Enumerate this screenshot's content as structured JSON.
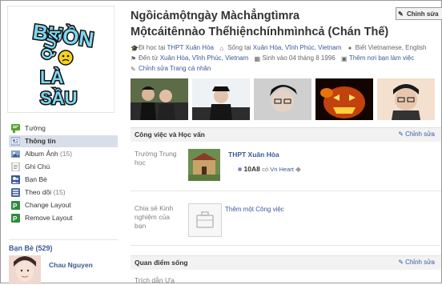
{
  "profile": {
    "name_line1": "Ngồicảmộtngày Màchẳngtìmra",
    "name_line2": "Mộtcáitênnào Thểhiệnchínhmìnhcả (Chán Thế)",
    "edit_profile_label": "Chỉnh sửa",
    "picture_text": [
      "BUỒN",
      "QUÁ",
      "LÀ",
      "SẦU"
    ]
  },
  "facts": {
    "studied_prefix": "Đi học tại ",
    "studied_link": "THPT Xuân Hòa",
    "lives_prefix": "Sống tại ",
    "lives_link": "Xuân Hòa, Vĩnh Phúc, Vietnam",
    "languages": "Biết Vietnamese, English",
    "from_prefix": "Đến từ ",
    "from_link": "Xuân Hòa, Vĩnh Phúc, Vietnam",
    "born": "Sinh vào 04 tháng 8 1996",
    "add_work": "Thêm nơi bạn làm việc",
    "edit_profile": "Chỉnh sửa Trang cá nhân"
  },
  "nav": [
    {
      "label": "Tường",
      "count": "",
      "icon": "wall-icon"
    },
    {
      "label": "Thông tin",
      "count": "",
      "icon": "info-icon"
    },
    {
      "label": "Album Ảnh",
      "count": " (15)",
      "icon": "photo-album-icon"
    },
    {
      "label": "Ghi Chú",
      "count": "",
      "icon": "notes-icon"
    },
    {
      "label": "Bạn Bè",
      "count": "",
      "icon": "friends-icon"
    },
    {
      "label": "Theo dõi",
      "count": " (15)",
      "icon": "subscribe-icon"
    },
    {
      "label": "Change Layout",
      "count": "",
      "icon": "layout-icon"
    },
    {
      "label": "Remove Layout",
      "count": "",
      "icon": "layout-icon"
    }
  ],
  "friends": {
    "title": "Bạn Bè (529)",
    "first_friend": "Chau Nguyen"
  },
  "work_edu": {
    "header": "Công việc và Học vấn",
    "edit": "Chỉnh sửa",
    "school_label": "Trường Trung học",
    "school_name": "THPT Xuân Hòa",
    "class_name": "10A8",
    "class_with_prefix": "có ",
    "class_with_name": "Vn Heart",
    "work_label": "Chia sẻ Kinh nghiệm của bạn",
    "add_work": "Thêm một Công việc"
  },
  "views": {
    "header": "Quan điểm sống",
    "edit": "Chỉnh sửa",
    "first_row_label": "Trích dẫn Ưa"
  },
  "colors": {
    "link": "#3b5998",
    "active_nav": "#d8dfea",
    "section_header": "#f2f2f2"
  }
}
